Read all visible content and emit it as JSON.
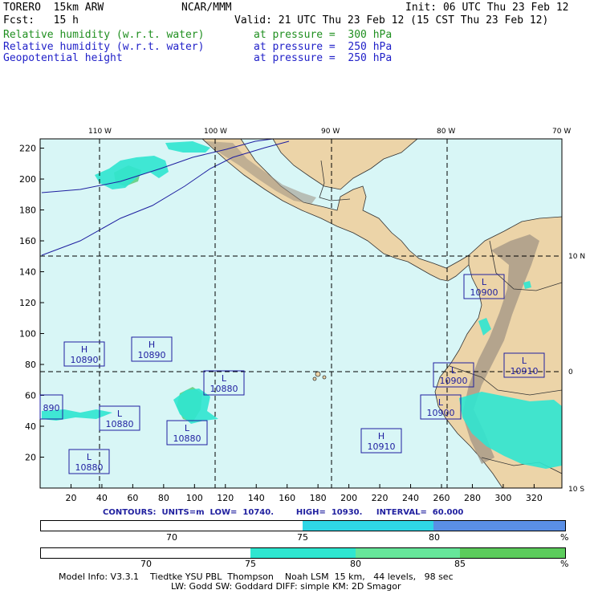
{
  "header": {
    "model": "TORERO  15km ARW",
    "center": "NCAR/MMM",
    "init": "Init: 06 UTC Thu 23 Feb 12",
    "fcst": "Fcst:   15 h",
    "valid": "Valid: 21 UTC Thu 23 Feb 12 (15 CST Thu 23 Feb 12)",
    "fields": [
      {
        "name": "Relative humidity (w.r.t. water)",
        "level": "at pressure =  300 hPa",
        "color": "#1f8f1f"
      },
      {
        "name": "Relative humidity (w.r.t. water)",
        "level": "at pressure =  250 hPa",
        "color": "#1f1fc8"
      },
      {
        "name": "Geopotential height",
        "level": "at pressure =  250 hPa",
        "color": "#1f1fc8"
      }
    ]
  },
  "axes": {
    "top_lon": [
      "110 W",
      "100 W",
      "90 W",
      "80 W",
      "70 W"
    ],
    "right_lat": [
      "10 N",
      "0",
      "10 S"
    ],
    "x_ticks": [
      "20",
      "40",
      "60",
      "80",
      "100",
      "120",
      "140",
      "160",
      "180",
      "200",
      "220",
      "240",
      "260",
      "280",
      "300",
      "320"
    ],
    "y_ticks": [
      "20",
      "40",
      "60",
      "80",
      "100",
      "120",
      "140",
      "160",
      "180",
      "200",
      "220"
    ]
  },
  "centers": [
    {
      "type": "H",
      "value": "10890"
    },
    {
      "type": "H",
      "value": "10890"
    },
    {
      "type": "L",
      "value": "10880"
    },
    {
      "type": "L",
      "value": "10880"
    },
    {
      "type": "L",
      "value": "10880"
    },
    {
      "type": "L",
      "value": "10880"
    },
    {
      "type": "L",
      "value": "10900"
    },
    {
      "type": "L",
      "value": "10900"
    },
    {
      "type": "L",
      "value": "10900"
    },
    {
      "type": "L",
      "value": "10910"
    },
    {
      "type": "H",
      "value": "10910"
    },
    {
      "type": "",
      "value": "890"
    }
  ],
  "contours": "CONTOURS:  UNITS=m  LOW=  10740.        HIGH=  10930.     INTERVAL=  60.000",
  "colorbar1": {
    "labels": [
      "70",
      "75",
      "80",
      "%"
    ],
    "colors": [
      "#ffffff",
      "#2fd6e6",
      "#5a8fe6"
    ]
  },
  "colorbar2": {
    "labels": [
      "70",
      "75",
      "80",
      "85",
      "%"
    ],
    "colors": [
      "#ffffff",
      "#2fe6d0",
      "#66e69a",
      "#5ccc5c"
    ]
  },
  "footer": {
    "line1": "Model Info: V3.3.1    Tiedtke YSU PBL  Thompson    Noah LSM  15 km,   44 levels,   98 sec",
    "line2": "LW: Godd SW: Goddard DIFF: simple KM: 2D Smagor"
  },
  "colors": {
    "ocean": "#d8f6f6",
    "land": "#ecd4a8",
    "terrain": "#9c9082",
    "contour": "#1f1fa0"
  }
}
